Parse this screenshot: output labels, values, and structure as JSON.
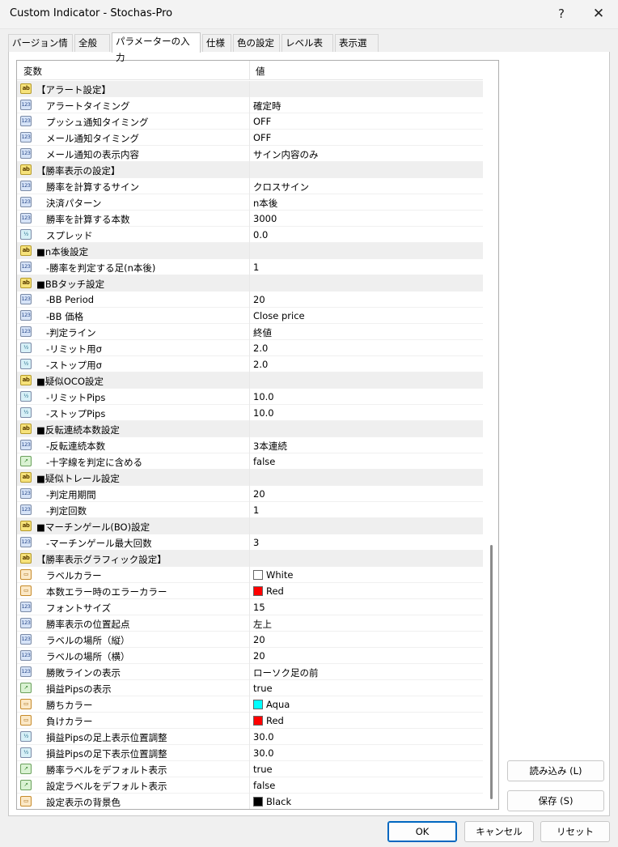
{
  "window": {
    "title": "Custom Indicator - Stochas-Pro",
    "help_glyph": "?",
    "close_glyph": "✕"
  },
  "tabs": [
    {
      "label": "バージョン情報"
    },
    {
      "label": "全般"
    },
    {
      "label": "パラメーターの入力"
    },
    {
      "label": "仕様"
    },
    {
      "label": "色の設定"
    },
    {
      "label": "レベル表示"
    },
    {
      "label": "表示選択"
    }
  ],
  "grid": {
    "col_variable": "変数",
    "col_value": "値",
    "rows": [
      {
        "type": "ab",
        "icon_label": "ab",
        "name": "【アラート設定】",
        "value": ""
      },
      {
        "type": "num",
        "icon_label": "123",
        "name": "アラートタイミング",
        "value": "確定時"
      },
      {
        "type": "num",
        "icon_label": "123",
        "name": "プッシュ通知タイミング",
        "value": "OFF"
      },
      {
        "type": "num",
        "icon_label": "123",
        "name": "メール通知タイミング",
        "value": "OFF"
      },
      {
        "type": "num",
        "icon_label": "123",
        "name": "メール通知の表示内容",
        "value": "サイン内容のみ"
      },
      {
        "type": "ab",
        "icon_label": "ab",
        "name": "【勝率表示の設定】",
        "value": ""
      },
      {
        "type": "num",
        "icon_label": "123",
        "name": "勝率を計算するサイン",
        "value": "クロスサイン"
      },
      {
        "type": "num",
        "icon_label": "123",
        "name": "決済パターン",
        "value": "n本後"
      },
      {
        "type": "num",
        "icon_label": "123",
        "name": "勝率を計算する本数",
        "value": "3000"
      },
      {
        "type": "dbl",
        "icon_label": "½",
        "name": "スプレッド",
        "value": "0.0"
      },
      {
        "type": "ab",
        "icon_label": "ab",
        "name": "■n本後設定",
        "value": ""
      },
      {
        "type": "num",
        "icon_label": "123",
        "name": "-勝率を判定する足(n本後)",
        "value": "1"
      },
      {
        "type": "ab",
        "icon_label": "ab",
        "name": "■BBタッチ設定",
        "value": ""
      },
      {
        "type": "num",
        "icon_label": "123",
        "name": "-BB Period",
        "value": "20"
      },
      {
        "type": "num",
        "icon_label": "123",
        "name": "-BB 価格",
        "value": "Close price"
      },
      {
        "type": "num",
        "icon_label": "123",
        "name": "-判定ライン",
        "value": "終値"
      },
      {
        "type": "dbl",
        "icon_label": "½",
        "name": "-リミット用σ",
        "value": "2.0"
      },
      {
        "type": "dbl",
        "icon_label": "½",
        "name": "-ストップ用σ",
        "value": "2.0"
      },
      {
        "type": "ab",
        "icon_label": "ab",
        "name": "■疑似OCO設定",
        "value": ""
      },
      {
        "type": "dbl",
        "icon_label": "½",
        "name": "-リミットPips",
        "value": "10.0"
      },
      {
        "type": "dbl",
        "icon_label": "½",
        "name": "-ストップPips",
        "value": "10.0"
      },
      {
        "type": "ab",
        "icon_label": "ab",
        "name": "■反転連続本数設定",
        "value": ""
      },
      {
        "type": "num",
        "icon_label": "123",
        "name": "-反転連続本数",
        "value": "3本連続"
      },
      {
        "type": "bool",
        "icon_label": "↗",
        "name": "-十字線を判定に含める",
        "value": "false"
      },
      {
        "type": "ab",
        "icon_label": "ab",
        "name": "■疑似トレール設定",
        "value": ""
      },
      {
        "type": "num",
        "icon_label": "123",
        "name": "-判定用期間",
        "value": "20"
      },
      {
        "type": "num",
        "icon_label": "123",
        "name": "-判定回数",
        "value": "1"
      },
      {
        "type": "ab",
        "icon_label": "ab",
        "name": "■マーチンゲール(BO)設定",
        "value": ""
      },
      {
        "type": "num",
        "icon_label": "123",
        "name": "-マーチンゲール最大回数",
        "value": "3"
      },
      {
        "type": "ab",
        "icon_label": "ab",
        "name": "【勝率表示グラフィック設定】",
        "value": ""
      },
      {
        "type": "clr",
        "icon_label": "▭",
        "name": "ラベルカラー",
        "value": "White",
        "color": "#ffffff"
      },
      {
        "type": "clr",
        "icon_label": "▭",
        "name": "本数エラー時のエラーカラー",
        "value": "Red",
        "color": "#ff0000"
      },
      {
        "type": "num",
        "icon_label": "123",
        "name": "フォントサイズ",
        "value": "15"
      },
      {
        "type": "num",
        "icon_label": "123",
        "name": "勝率表示の位置起点",
        "value": "左上"
      },
      {
        "type": "num",
        "icon_label": "123",
        "name": "ラベルの場所（縦）",
        "value": "20"
      },
      {
        "type": "num",
        "icon_label": "123",
        "name": "ラベルの場所（横）",
        "value": "20"
      },
      {
        "type": "num",
        "icon_label": "123",
        "name": "勝敗ラインの表示",
        "value": "ローソク足の前"
      },
      {
        "type": "bool",
        "icon_label": "↗",
        "name": "損益Pipsの表示",
        "value": "true"
      },
      {
        "type": "clr",
        "icon_label": "▭",
        "name": "勝ちカラー",
        "value": "Aqua",
        "color": "#00ffff"
      },
      {
        "type": "clr",
        "icon_label": "▭",
        "name": "負けカラー",
        "value": "Red",
        "color": "#ff0000"
      },
      {
        "type": "dbl",
        "icon_label": "½",
        "name": "損益Pipsの足上表示位置調整",
        "value": "30.0"
      },
      {
        "type": "dbl",
        "icon_label": "½",
        "name": "損益Pipsの足下表示位置調整",
        "value": "30.0"
      },
      {
        "type": "bool",
        "icon_label": "↗",
        "name": "勝率ラベルをデフォルト表示",
        "value": "true"
      },
      {
        "type": "bool",
        "icon_label": "↗",
        "name": "設定ラベルをデフォルト表示",
        "value": "false"
      },
      {
        "type": "clr",
        "icon_label": "▭",
        "name": "設定表示の背景色",
        "value": "Black",
        "color": "#000000"
      }
    ]
  },
  "buttons": {
    "load": "読み込み (L)",
    "save": "保存 (S)",
    "ok": "OK",
    "cancel": "キャンセル",
    "reset": "リセット"
  }
}
